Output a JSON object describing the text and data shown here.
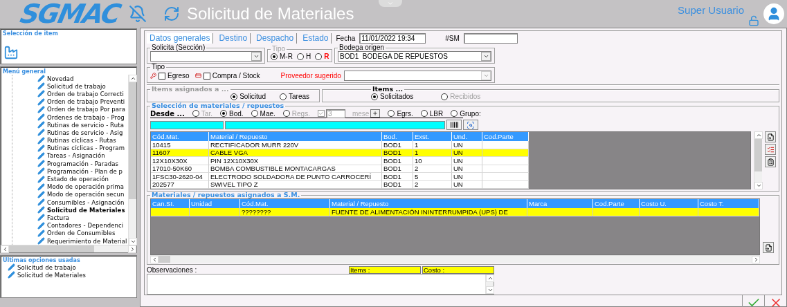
{
  "header": {
    "logo": "SGMAC",
    "title": "Solicitud de Materiales",
    "user": "Super Usuario"
  },
  "sidebar": {
    "selection_title": "Selección de item",
    "menu_title": "Menú general",
    "menu_items": [
      {
        "label": "Novedad",
        "selected": false
      },
      {
        "label": "Solicitud de trabajo",
        "selected": false
      },
      {
        "label": "Orden de trabajo Correcti",
        "selected": false
      },
      {
        "label": "Orden de trabajo Preventi",
        "selected": false
      },
      {
        "label": "Orden de trabajo Por para",
        "selected": false
      },
      {
        "label": "Ordenes de trabajo - Prog",
        "selected": false
      },
      {
        "label": "Rutinas de servicio - Ruta",
        "selected": false
      },
      {
        "label": "Rutinas de servicio - Asig",
        "selected": false
      },
      {
        "label": "Rutinas cíclicas - Rutas",
        "selected": false
      },
      {
        "label": "Rutinas cíclicas - Program",
        "selected": false
      },
      {
        "label": "Tareas - Asignación",
        "selected": false
      },
      {
        "label": "Programación - Paradas",
        "selected": false
      },
      {
        "label": "Programación - Plan de p",
        "selected": false
      },
      {
        "label": "Estado de operación",
        "selected": false
      },
      {
        "label": "Modo de operación prima",
        "selected": false
      },
      {
        "label": "Modo de operación secun",
        "selected": false
      },
      {
        "label": "Consumibles - Asignación",
        "selected": false
      },
      {
        "label": "Solicitud de Materiales",
        "selected": true
      },
      {
        "label": "Factura",
        "selected": false
      },
      {
        "label": "Contadores - Dependenci",
        "selected": false
      },
      {
        "label": "Orden de Consumibles",
        "selected": false
      },
      {
        "label": "Requerimiento de Material",
        "selected": false
      }
    ],
    "recent_title": "Ultimas opciones usadas",
    "recent_items": [
      "Solicitud de trabajo",
      "Solicitud de Materiales"
    ]
  },
  "form": {
    "tabs": [
      {
        "label": "Datos generales",
        "selected": true
      },
      {
        "label": "Destino",
        "selected": false
      },
      {
        "label": "Despacho",
        "selected": false
      },
      {
        "label": "Estado",
        "selected": false
      }
    ],
    "fecha_label": "Fecha",
    "fecha": "11/01/2022 19:34",
    "sm_label": "#SM",
    "solicita_label": "Solicita (Sección)",
    "tipo_label": "Tipo",
    "tipo_options": [
      {
        "label": "M-R",
        "selected": true,
        "color": "#000000"
      },
      {
        "label": "H",
        "selected": false,
        "color": "#000000"
      },
      {
        "label": "R",
        "selected": false,
        "color": "#ff0000"
      }
    ],
    "bodega_label": "Bodega origen",
    "bodega": "BOD1  BODEGA DE REPUESTOS",
    "tipo2_label": "Tipo",
    "tipo2_options": [
      {
        "label": "Egreso",
        "checked": false
      },
      {
        "label": "Compra / Stock",
        "checked": false
      }
    ],
    "proveedor_label": "Proveedor sugerido"
  },
  "assigned": {
    "label": "Items asignados a ...",
    "options": [
      {
        "label": "Solicitud",
        "selected": true,
        "disabled": false
      },
      {
        "label": "Tareas",
        "selected": false,
        "disabled": false
      }
    ]
  },
  "items": {
    "label": "Items ...",
    "options": [
      {
        "label": "Solicitados",
        "selected": true,
        "disabled": false
      },
      {
        "label": "Recibidos",
        "selected": false,
        "disabled": true
      }
    ]
  },
  "selection": {
    "title": "Selección de materiales / repuestos",
    "desde_label": "Desde ...",
    "options": [
      {
        "kind": "radio",
        "label": "Tar.",
        "selected": false,
        "disabled": true
      },
      {
        "kind": "radio",
        "label": "Bod.",
        "selected": true,
        "disabled": false
      },
      {
        "kind": "radio",
        "label": "Mae.",
        "selected": false,
        "disabled": false
      },
      {
        "kind": "radio",
        "label": "Regs.",
        "selected": false,
        "disabled": true
      },
      {
        "kind": "months",
        "checked": true,
        "value": "3",
        "unit": "mese"
      },
      {
        "kind": "radio",
        "label": "Egrs.",
        "selected": false,
        "disabled": false
      },
      {
        "kind": "radio",
        "label": "LBR",
        "selected": false,
        "disabled": false
      },
      {
        "kind": "radio",
        "label": "Grupo:",
        "selected": false,
        "disabled": false
      }
    ],
    "columns": [
      "Cód.Mat.",
      "Material / Repuesto",
      "Bod.",
      "Exst.",
      "Und.",
      "Cod.Parte"
    ],
    "rows": [
      {
        "selected": false,
        "cells": [
          "10415",
          "RECTIFICADOR MURR 220V",
          "BOD1",
          "1",
          "UN"
        ]
      },
      {
        "selected": true,
        "cells": [
          "11607",
          "CABLE VGA",
          "BOD1",
          "1",
          "UN"
        ]
      },
      {
        "selected": false,
        "cells": [
          "12X10X30X",
          "PIN 12X10X30X",
          "BOD1",
          "10",
          "UN"
        ]
      },
      {
        "selected": false,
        "cells": [
          "17010-50K60",
          "BOMBA COMBUSTIBLE MONTACARGAS",
          "BOD1",
          "2",
          "UN"
        ]
      },
      {
        "selected": false,
        "cells": [
          "1FSC30-2620-04",
          "ELECTRODO SOLDADORA DE PUNTO CARROCERÍ",
          "BOD1",
          "5",
          "UN"
        ]
      },
      {
        "selected": false,
        "cells": [
          "202577",
          "SWIVEL TIPO Z",
          "BOD1",
          "2",
          "UN"
        ]
      }
    ]
  },
  "assigned_materials": {
    "title": "Materiales / repuestos asignados a S.M.",
    "columns": [
      "Can.SI.",
      "Unidad",
      "Cód.Mat.",
      "Material / Repuesto",
      "Marca",
      "Cod.Parte",
      "Costo U.",
      "Costo T."
    ],
    "rows": [
      {
        "selected": true,
        "cells": [
          null,
          null,
          "????????",
          "FUENTE DE ALIMENTACIÓN ININTERRUMPIDA (UPS) DE"
        ]
      }
    ]
  },
  "footer": {
    "observaciones_label": "Observaciones :",
    "items_label": "Items :",
    "costo_label": "Costo :"
  }
}
